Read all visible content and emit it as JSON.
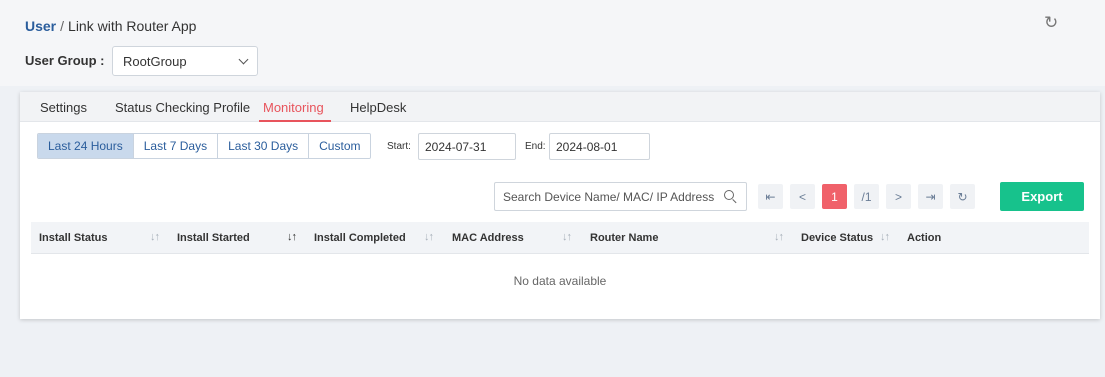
{
  "breadcrumb": {
    "root": "User",
    "separator": "/",
    "current": "Link with Router App"
  },
  "refresh_icon": "refresh-icon",
  "user_group": {
    "label": "User Group :",
    "selected": "RootGroup"
  },
  "tabs": [
    {
      "label": "Settings",
      "active": false
    },
    {
      "label": "Status Checking Profile",
      "active": false
    },
    {
      "label": "Monitoring",
      "active": true
    },
    {
      "label": "HelpDesk",
      "active": false
    }
  ],
  "time_range": [
    {
      "label": "Last 24 Hours",
      "active": true
    },
    {
      "label": "Last 7 Days",
      "active": false
    },
    {
      "label": "Last 30 Days",
      "active": false
    },
    {
      "label": "Custom",
      "active": false
    }
  ],
  "start": {
    "label": "Start:",
    "value": "2024-07-31"
  },
  "end": {
    "label": "End:",
    "value": "2024-08-01"
  },
  "search": {
    "placeholder": "Search Device Name/ MAC/ IP Address"
  },
  "pagination": {
    "first": "K",
    "prev": "<",
    "current": "1",
    "total": "/1",
    "next": ">",
    "last": "›|",
    "refresh": "C"
  },
  "export_label": "Export",
  "table": {
    "columns": [
      "Install Status",
      "Install Started",
      "Install Completed",
      "MAC Address",
      "Router Name",
      "Device Status",
      "Action"
    ],
    "empty_text": "No data available"
  },
  "colors": {
    "accent": "#e8545c",
    "primary": "#2a5d9c",
    "export": "#17c28c"
  }
}
